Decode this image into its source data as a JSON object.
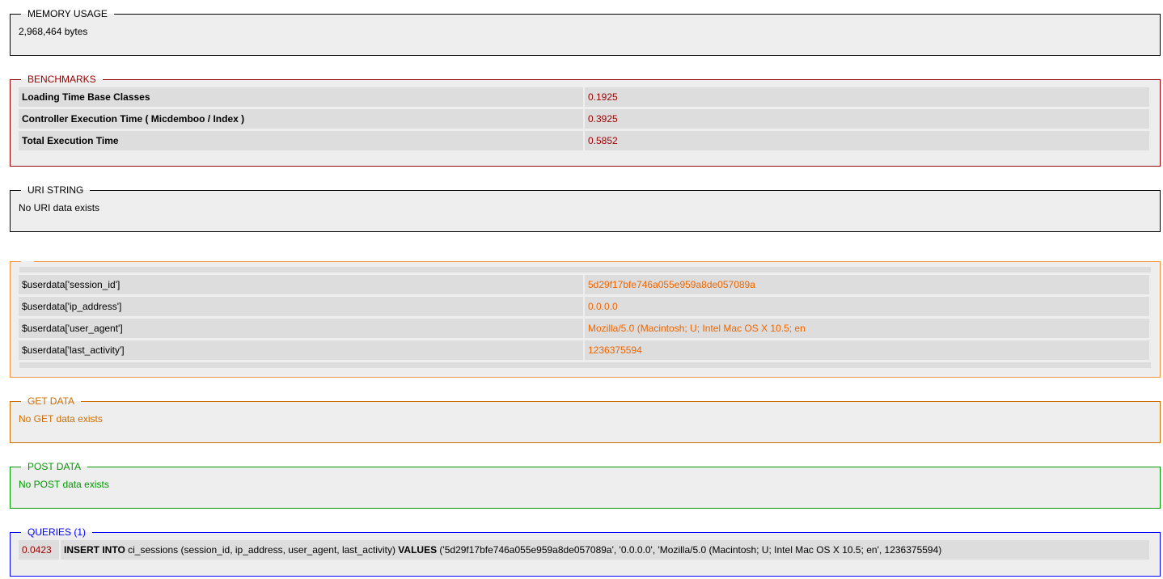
{
  "memory": {
    "legend": "MEMORY USAGE",
    "value": "2,968,464 bytes"
  },
  "benchmarks": {
    "legend": "BENCHMARKS",
    "rows": [
      {
        "label": "Loading Time Base Classes",
        "value": "0.1925"
      },
      {
        "label": "Controller Execution Time ( Micdemboo / Index )",
        "value": "0.3925"
      },
      {
        "label": "Total Execution Time",
        "value": "0.5852"
      }
    ]
  },
  "uri": {
    "legend": "URI STRING",
    "value": "No URI data exists"
  },
  "session": {
    "legend": "",
    "rows": [
      {
        "key": "$userdata['session_id']",
        "value": "5d29f17bfe746a055e959a8de057089a"
      },
      {
        "key": "$userdata['ip_address']",
        "value": "0.0.0.0"
      },
      {
        "key": "$userdata['user_agent']",
        "value": "Mozilla/5.0 (Macintosh; U; Intel Mac OS X 10.5; en"
      },
      {
        "key": "$userdata['last_activity']",
        "value": "1236375594"
      }
    ]
  },
  "get": {
    "legend": "GET DATA",
    "value": "No GET data exists"
  },
  "post": {
    "legend": "POST DATA",
    "value": "No POST data exists"
  },
  "queries": {
    "legend": "QUERIES (1)",
    "items": [
      {
        "time": "0.0423",
        "kw1": "INSERT INTO",
        "part1": " ci_sessions (session_id, ip_address, user_agent, last_activity) ",
        "kw2": "VALUES",
        "part2": " ('5d29f17bfe746a055e959a8de057089a', '0.0.0.0', 'Mozilla/5.0 (Macintosh; U; Intel Mac OS X 10.5; en', 1236375594)"
      }
    ]
  },
  "colors": {
    "benchmarks": "#990000",
    "session": "#ee6600",
    "get": "#cd6e00",
    "post": "#009900",
    "queries": "#0000ff"
  }
}
